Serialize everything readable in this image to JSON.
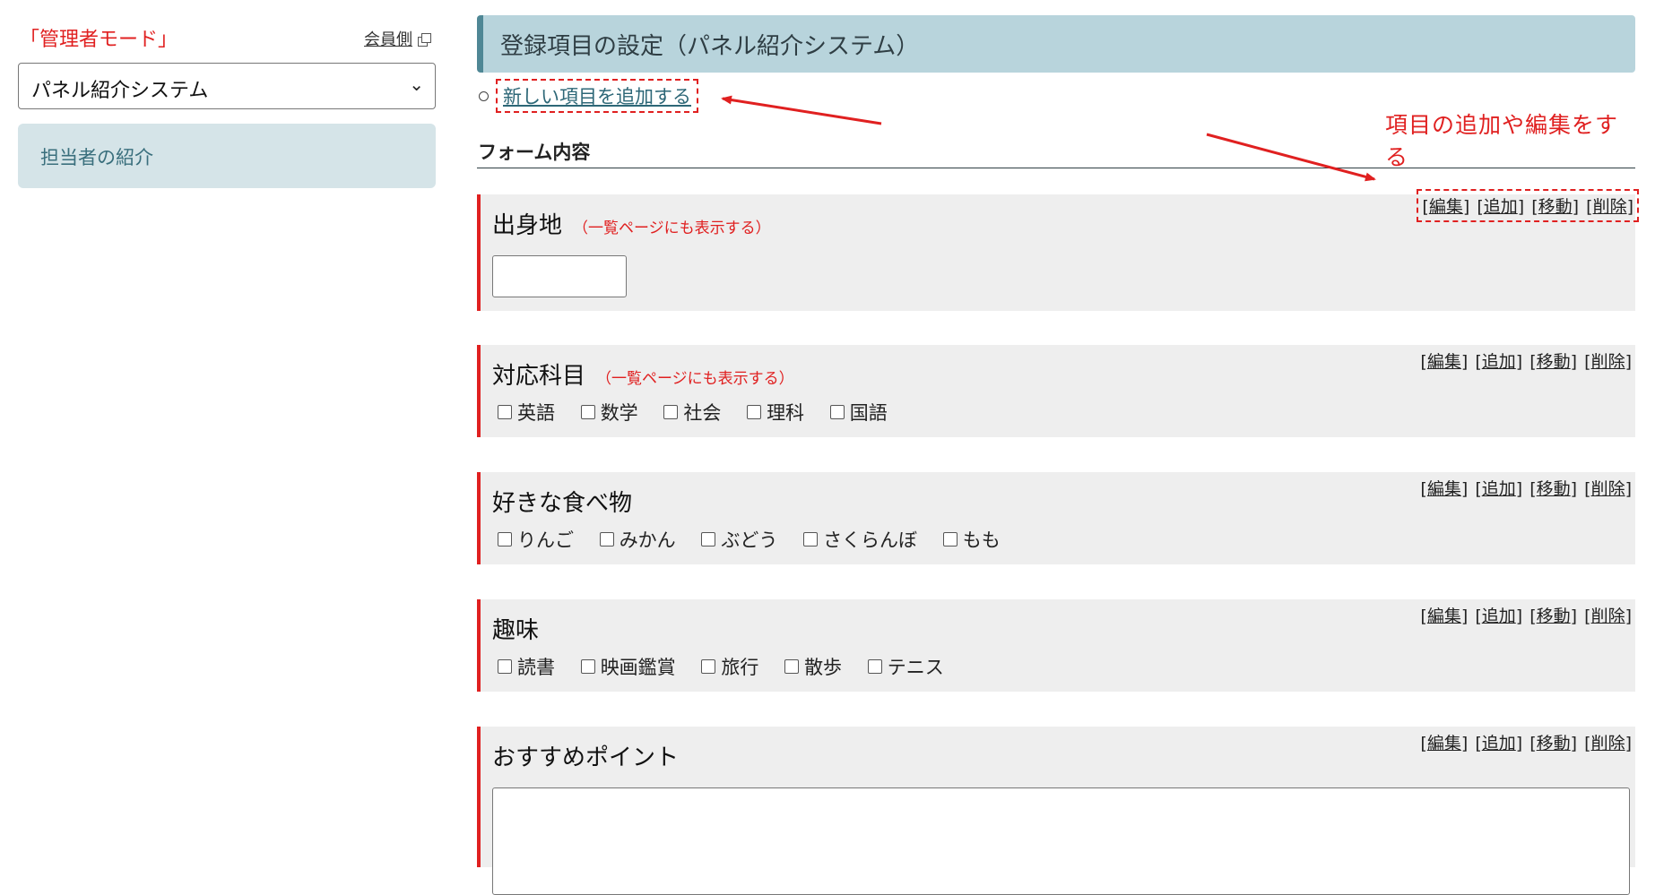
{
  "sidebar": {
    "mode_label": "「管理者モード」",
    "member_link": "会員側",
    "select_value": "パネル紹介システム",
    "nav_item": "担当者の紹介"
  },
  "header": {
    "title": "登録項目の設定（パネル紹介システム）"
  },
  "add_link": "新しい項目を追加する",
  "callout": "項目の追加や編集をする",
  "section_title": "フォーム内容",
  "actions": {
    "edit": "編集",
    "add": "追加",
    "move": "移動",
    "delete": "削除"
  },
  "fields": [
    {
      "label": "出身地",
      "note": "（一覧ページにも表示する）",
      "type": "text"
    },
    {
      "label": "対応科目",
      "note": "（一覧ページにも表示する）",
      "type": "checkbox",
      "options": [
        "英語",
        "数学",
        "社会",
        "理科",
        "国語"
      ]
    },
    {
      "label": "好きな食べ物",
      "note": "",
      "type": "checkbox",
      "options": [
        "りんご",
        "みかん",
        "ぶどう",
        "さくらんぼ",
        "もも"
      ]
    },
    {
      "label": "趣味",
      "note": "",
      "type": "checkbox",
      "options": [
        "読書",
        "映画鑑賞",
        "旅行",
        "散歩",
        "テニス"
      ]
    },
    {
      "label": "おすすめポイント",
      "note": "",
      "type": "textarea"
    }
  ],
  "colors": {
    "accent_red": "#e02020",
    "header_bg": "#b8d4dc",
    "header_border": "#4f8795",
    "nav_bg": "#d5e4e8",
    "field_bg": "#eeeeee"
  }
}
